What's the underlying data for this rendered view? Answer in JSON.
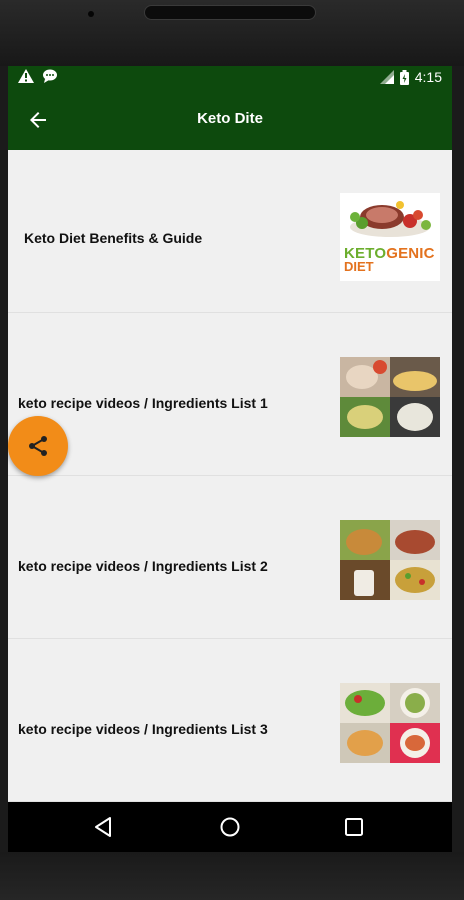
{
  "statusbar": {
    "time": "4:15"
  },
  "appbar": {
    "title": "Keto Dite"
  },
  "items": [
    {
      "label": "Keto Diet Benefits & Guide",
      "thumb_text_1": "KETOGENIC",
      "thumb_text_2": "DIET"
    },
    {
      "label": "keto recipe videos / Ingredients List 1"
    },
    {
      "label": "keto recipe videos / Ingredients List 2"
    },
    {
      "label": "keto recipe videos / Ingredients List 3"
    }
  ],
  "colors": {
    "appbar": "#0d4a0d",
    "fab": "#f28c18"
  },
  "icons": {
    "back": "arrow-left-icon",
    "fab": "share-icon",
    "nav_back": "triangle-back-icon",
    "nav_home": "circle-home-icon",
    "nav_recent": "square-recents-icon"
  }
}
